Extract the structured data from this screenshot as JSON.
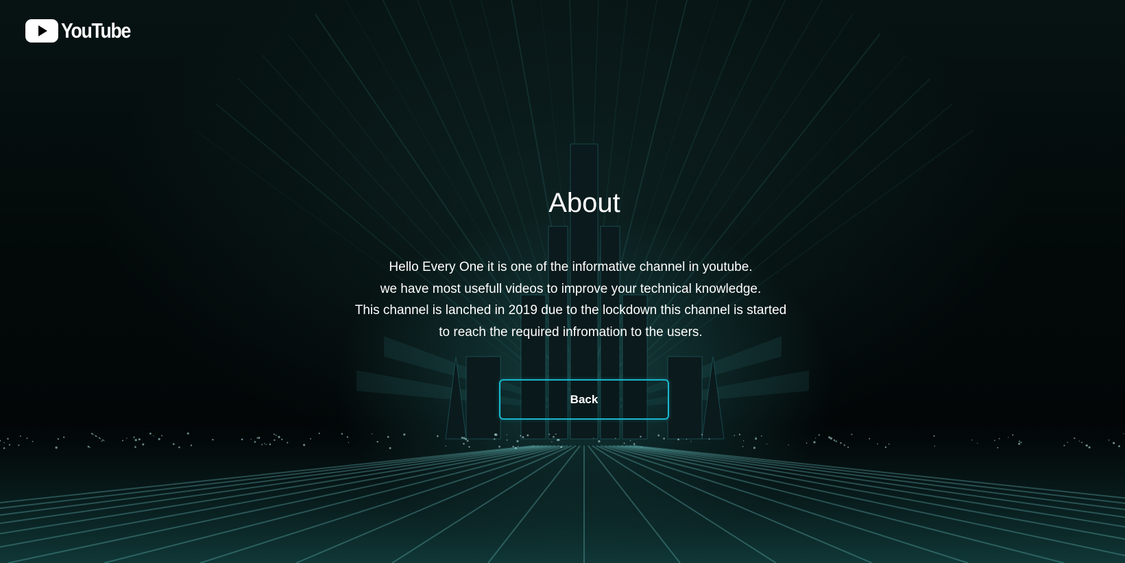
{
  "header": {
    "logo_icon": "youtube-play-icon",
    "logo_text": "YouTube"
  },
  "main": {
    "title": "About",
    "description_lines": [
      "Hello Every One it is one of the informative channel in youtube.",
      "we have most usefull videos to improve your technical knowledge.",
      "This channel is lanched in 2019 due to the lockdown this channel is started",
      "to reach the required infromation to the users."
    ],
    "back_label": "Back"
  },
  "colors": {
    "accent": "#19b6cc",
    "background": "#020808",
    "text": "#ffffff"
  }
}
